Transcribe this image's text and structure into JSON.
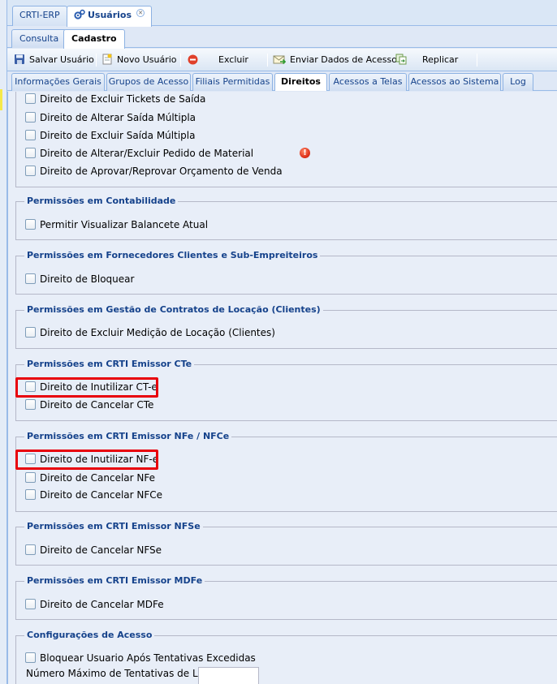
{
  "window_tabs": [
    {
      "label": "CRTI-ERP"
    },
    {
      "label": "Usuários",
      "active": true
    }
  ],
  "sub_tabs": [
    {
      "label": "Consulta"
    },
    {
      "label": "Cadastro",
      "active": true
    }
  ],
  "toolbar": {
    "save_label": "Salvar Usuário",
    "new_label": "Novo Usuário",
    "delete_label": "Excluir",
    "send_label": "Enviar Dados de Acesso",
    "replicate_label": "Replicar"
  },
  "detail_tabs": [
    {
      "label": "Informações Gerais"
    },
    {
      "label": "Grupos de Acesso"
    },
    {
      "label": "Filiais Permitidas"
    },
    {
      "label": "Direitos",
      "active": true
    },
    {
      "label": "Acessos a Telas"
    },
    {
      "label": "Acessos ao Sistema"
    },
    {
      "label": "Log"
    }
  ],
  "sections": {
    "top": {
      "items": [
        "Direito de Excluir Tickets de Saída",
        "Direito de Alterar Saída Múltipla",
        "Direito de Excluir Saída Múltipla",
        "Direito de Alterar/Excluir Pedido de Material",
        "Direito de Aprovar/Reprovar Orçamento de Venda"
      ]
    },
    "contabilidade": {
      "title": "Permissões em Contabilidade",
      "items": [
        "Permitir Visualizar Balancete Atual"
      ]
    },
    "fornecedores": {
      "title": "Permissões em Fornecedores Clientes e Sub-Empreiteiros",
      "items": [
        "Direito de Bloquear"
      ]
    },
    "contratos": {
      "title": "Permissões em Gestão de Contratos de Locação (Clientes)",
      "items": [
        "Direito de Excluir Medição de Locação (Clientes)"
      ]
    },
    "cte": {
      "title": "Permissões em CRTI Emissor CTe",
      "items": [
        "Direito de Inutilizar CT-e",
        "Direito de Cancelar CTe"
      ]
    },
    "nfe": {
      "title": "Permissões em CRTI Emissor NFe / NFCe",
      "items": [
        "Direito de Inutilizar NF-e",
        "Direito de Cancelar NFe",
        "Direito de Cancelar NFCe"
      ]
    },
    "nfse": {
      "title": "Permissões em CRTI Emissor NFSe",
      "items": [
        "Direito de Cancelar NFSe"
      ]
    },
    "mdfe": {
      "title": "Permissões em CRTI Emissor MDFe",
      "items": [
        "Direito de Cancelar MDFe"
      ]
    },
    "acesso": {
      "title": "Configurações de Acesso",
      "items": [
        "Bloquear Usuario Após Tentativas Excedidas"
      ],
      "max_attempts_label": "Número Máximo de Tentativas de Login:",
      "max_attempts_value": ""
    }
  },
  "warning_icon_glyph": "!",
  "colors": {
    "highlight": "#e8000b",
    "legend_text": "#15428b"
  }
}
